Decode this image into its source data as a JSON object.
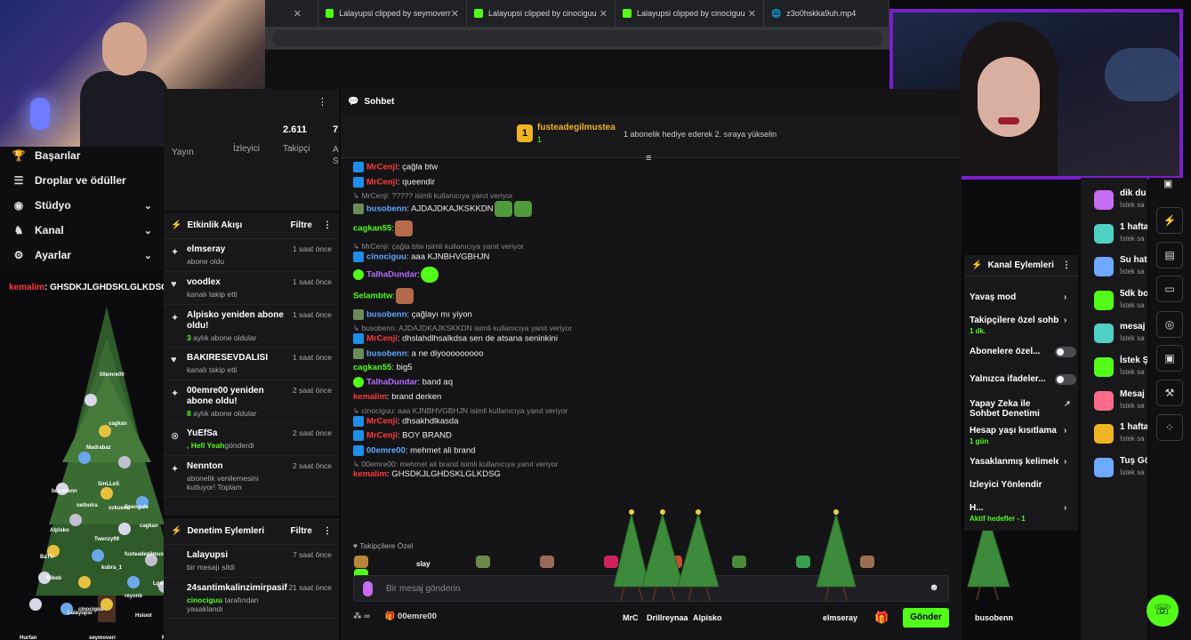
{
  "browser": {
    "tabs": [
      {
        "label": "Lalayupsi clipped by seymoverr"
      },
      {
        "label": "Lalayupsi clipped by cinociguu"
      },
      {
        "label": "Lalayupsi clipped by cinociguu"
      },
      {
        "label": "z3o0hskka9uh.mp4"
      }
    ]
  },
  "overlay_message": {
    "user": "kemalim",
    "text": ": GHSDKJLGHDSKLGLKDSG"
  },
  "left_menu": [
    {
      "icon": "trophy-icon",
      "label": "Başarılar",
      "chevron": false
    },
    {
      "icon": "gift-icon",
      "label": "Droplar ve ödüller",
      "chevron": false
    },
    {
      "icon": "studio-icon",
      "label": "Stüdyo",
      "chevron": true
    },
    {
      "icon": "channel-icon",
      "label": "Kanal",
      "chevron": true
    },
    {
      "icon": "gear-icon",
      "label": "Ayarlar",
      "chevron": true
    }
  ],
  "stats": {
    "values": [
      "2.611",
      "7"
    ],
    "labels": [
      "Yayın",
      "İzleyici",
      "Takipçi",
      "A S"
    ]
  },
  "activity": {
    "title": "Etkinlik Akışı",
    "filter": "Filtre",
    "items": [
      {
        "icon": "sparkle-icon",
        "name": "elmseray",
        "sub": "abone oldu",
        "time": "1 saat önce",
        "highlight": ""
      },
      {
        "icon": "heart-icon",
        "name": "voodlex",
        "sub": "kanalı takip etti",
        "time": "1 saat önce",
        "highlight": ""
      },
      {
        "icon": "sparkle-icon",
        "name": "Alpisko yeniden abone oldu!",
        "sub": " aylık abone oldular",
        "time": "1 saat önce",
        "highlight": "3"
      },
      {
        "icon": "heart-icon",
        "name": "BAKIRESEVDALISI",
        "sub": "kanalı takip etti",
        "time": "1 saat önce",
        "highlight": ""
      },
      {
        "icon": "sparkle-icon",
        "name": "00emre00 yeniden abone oldu!",
        "sub": " aylık abone oldular",
        "time": "2 saat önce",
        "highlight": "8"
      },
      {
        "icon": "x-circle-icon",
        "name": "YuEfSa",
        "sub": "gönderdi",
        "time": "2 saat önce",
        "highlight": ", Hell Yeah"
      },
      {
        "icon": "sparkle-icon",
        "name": "Nennton",
        "sub": "abonelik venilemesini kutluyor! Toplam",
        "time": "2 saat önce",
        "highlight": ""
      }
    ]
  },
  "moderation": {
    "title": "Denetim Eylemleri",
    "filter": "Filtre",
    "items": [
      {
        "name": "Lalayupsi",
        "sub": "bir mesajı sildi",
        "time": "7 saat önce",
        "highlight": ""
      },
      {
        "name": "24santimkalinzimirpasif",
        "sub": " tarafından yasaklandı",
        "time": "21 saat önce",
        "highlight": "cinociguu"
      }
    ]
  },
  "chat": {
    "title": "Sohbet",
    "pinned": {
      "badge": "1",
      "user": "fusteadegilmustea",
      "count": "1",
      "info": "1 abonelik hediye ederek 2. sıraya yükselin"
    },
    "messages": [
      {
        "reply": "",
        "user": "MrCenji",
        "cls": "u-mrc",
        "badge": "mod",
        "text": ": çağla btw"
      },
      {
        "reply": "",
        "user": "MrCenji",
        "cls": "u-mrc",
        "badge": "mod",
        "text": ": queendir"
      },
      {
        "reply": "MrCenji: ????? isimli kullanıcıya yanıt veriyor",
        "user": "busobenn",
        "cls": "u-buso",
        "badge": "pepe",
        "text": ": AJDAJDKAJKSKKDN"
      },
      {
        "reply": "",
        "user": "cagkan55",
        "cls": "u-cag",
        "badge": "",
        "text": ":"
      },
      {
        "reply": "MrCenji: çağla btw isimli kullanıcıya yanıt veriyor",
        "user": "cinociguu",
        "cls": "u-cino",
        "badge": "mod",
        "text": ": aaa KJNBHVGBHJN"
      },
      {
        "reply": "",
        "user": "TalhaDundar",
        "cls": "u-tal",
        "badge": "sub",
        "text": ":"
      },
      {
        "reply": "",
        "user": "Selambtw",
        "cls": "u-sel",
        "badge": "",
        "text": ":"
      },
      {
        "reply": "",
        "user": "busobenn",
        "cls": "u-buso",
        "badge": "pepe",
        "text": ": çağlayı mı yiyon"
      },
      {
        "reply": "busobenn: AJDAJDKAJKSKKDN isimli kullanıcıya yanıt veriyor",
        "user": "MrCenji",
        "cls": "u-mrc",
        "badge": "mod",
        "text": ": dhslahdlhsalkdsa sen de atsana seninkini"
      },
      {
        "reply": "",
        "user": "busobenn",
        "cls": "u-buso",
        "badge": "pepe",
        "text": ": a ne diyooooooooo"
      },
      {
        "reply": "",
        "user": "cagkan55",
        "cls": "u-cag",
        "badge": "",
        "text": ": big5"
      },
      {
        "reply": "",
        "user": "TalhaDundar",
        "cls": "u-tal",
        "badge": "sub",
        "text": ": band aq"
      },
      {
        "reply": "",
        "user": "kemalim",
        "cls": "u-kem",
        "badge": "",
        "text": ": brand derken"
      },
      {
        "reply": "cinociguu: aaa KJNBHVGBHJN isimli kullanıcıya yanıt veriyor",
        "user": "MrCenji",
        "cls": "u-mrc",
        "badge": "mod",
        "text": ": dhsakhdlkasda"
      },
      {
        "reply": "",
        "user": "MrCenji",
        "cls": "u-mrc",
        "badge": "mod",
        "text": ": BOY BRAND"
      },
      {
        "reply": "",
        "user": "00emre00",
        "cls": "u-emr",
        "badge": "mod",
        "text": ": mehmet ali brand"
      },
      {
        "reply": "00emre00: mehmet ali brand isimli kullanıcıya yanıt veriyor",
        "user": "kemalim",
        "cls": "u-kem",
        "badge": "",
        "text": ": GHSDKJLGHDSKLGLKDSG"
      }
    ],
    "follower_label": "Takipçilere Özel",
    "input_placeholder": "Bir mesaj gönderin",
    "send_label": "Gönder",
    "bottom_user": "00emre00",
    "overlay_names": [
      "MrC",
      "Drillreynaa",
      "Alpisko",
      "elmseray",
      "busobenn"
    ],
    "overlay_slay": "slay"
  },
  "channel_actions": {
    "title": "Kanal Eylemleri",
    "items": [
      {
        "label": "Yavaş mod",
        "control": "chevron",
        "sub": ""
      },
      {
        "label": "Takipçilere özel sohb",
        "control": "chevron",
        "sub": "1 dk."
      },
      {
        "label": "Abonelere özel...",
        "control": "toggle",
        "sub": ""
      },
      {
        "label": "Yalnızca ifadeler...",
        "control": "toggle",
        "sub": ""
      },
      {
        "label": "Yapay Zeka ile Sohbet Denetimi",
        "control": "external",
        "sub": ""
      },
      {
        "label": "Hesap yaşı kısıtlama",
        "control": "chevron",
        "sub": "1 gün"
      },
      {
        "label": "Yasaklanmış kelimele",
        "control": "chevron",
        "sub": ""
      },
      {
        "label": "İzleyici Yönlendir",
        "control": "none",
        "sub": ""
      },
      {
        "label": "H...",
        "control": "chevron",
        "sub": "Aktif hedefler - 1"
      }
    ]
  },
  "right_list": [
    {
      "name": "dik du",
      "sub": "İstek sa",
      "color": "#c56cf0"
    },
    {
      "name": "1 hafta",
      "sub": "İstek sa",
      "color": "#4fd1c5"
    },
    {
      "name": "Su hat",
      "sub": "İstek sa",
      "color": "#6fa8ff"
    },
    {
      "name": "5dk bo",
      "sub": "İstek sa",
      "color": "#53fc18"
    },
    {
      "name": "mesaj",
      "sub": "İstek sa",
      "color": "#4fd1c5"
    },
    {
      "name": "İstek Ş",
      "sub": "İstek sa",
      "color": "#53fc18"
    },
    {
      "name": "Mesaj",
      "sub": "İstek sa",
      "color": "#ff6b8a"
    },
    {
      "name": "1 hafta",
      "sub": "İstek sa",
      "color": "#f0b323"
    },
    {
      "name": "Tuş Gö",
      "sub": "İstek sa",
      "color": "#6fa8ff"
    }
  ],
  "tree_names": [
    "00emre00",
    "cagkan",
    "Madrabaz",
    "SinLLeS",
    "Spengule",
    "busobenn",
    "netholra",
    "ozkuemi",
    "cagkan",
    "Alpisko",
    "Twenzy99",
    "BaTh",
    "fusteadegilmustea",
    "kubra_1",
    "Mikeb",
    "reyonb",
    "Lgedoom",
    "cinociguu",
    "Lalayupsi",
    "Hsloot",
    "elmseray",
    "Hurfan",
    "seymoverr",
    "MrCenji"
  ]
}
